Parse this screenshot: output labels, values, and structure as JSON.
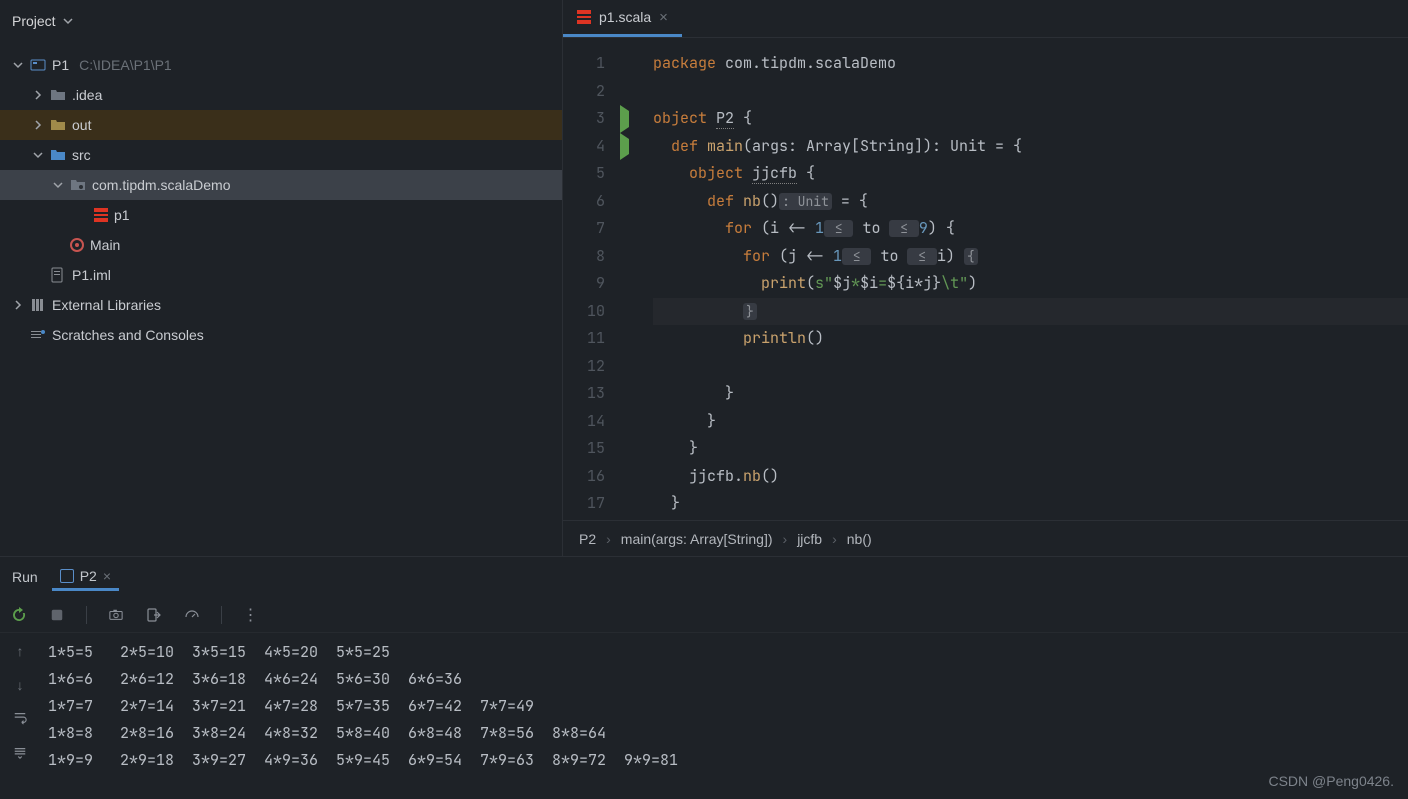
{
  "project": {
    "title": "Project",
    "root": {
      "name": "P1",
      "path": "C:\\IDEA\\P1\\P1"
    },
    "nodes": {
      "idea": ".idea",
      "out": "out",
      "src": "src",
      "pkg": "com.tipdm.scalaDemo",
      "p1": "p1",
      "main": "Main",
      "iml": "P1.iml",
      "ext": "External Libraries",
      "scratches": "Scratches and Consoles"
    }
  },
  "editor": {
    "tab_name": "p1.scala",
    "lines": {
      "1": {
        "segments": [
          {
            "t": "package ",
            "c": "kw"
          },
          {
            "t": "com.tipdm.scalaDemo",
            "c": "pkg"
          }
        ]
      },
      "2": {
        "segments": [
          {
            "t": "",
            "c": ""
          }
        ]
      },
      "3": {
        "segments": [
          {
            "t": "object ",
            "c": "kw"
          },
          {
            "t": "P2",
            "c": "decl"
          },
          {
            "t": " {",
            "c": ""
          }
        ]
      },
      "4": {
        "segments": [
          {
            "t": "  ",
            "c": ""
          },
          {
            "t": "def ",
            "c": "kw"
          },
          {
            "t": "main",
            "c": "fn"
          },
          {
            "t": "(args: Array[String]): Unit = {",
            "c": ""
          }
        ]
      },
      "5": {
        "segments": [
          {
            "t": "    ",
            "c": ""
          },
          {
            "t": "object ",
            "c": "kw"
          },
          {
            "t": "jjcfb",
            "c": "decl"
          },
          {
            "t": " {",
            "c": ""
          }
        ]
      },
      "6": {
        "segments": [
          {
            "t": "      ",
            "c": ""
          },
          {
            "t": "def ",
            "c": "kw"
          },
          {
            "t": "nb",
            "c": "fn"
          },
          {
            "t": "()",
            "c": ""
          },
          {
            "t": ": Unit",
            "c": "hint"
          },
          {
            "t": " = {",
            "c": ""
          }
        ]
      },
      "7": {
        "segments": [
          {
            "t": "        ",
            "c": ""
          },
          {
            "t": "for ",
            "c": "kw"
          },
          {
            "t": "(i <- ",
            "c": ""
          },
          {
            "t": "1",
            "c": "num"
          },
          {
            "t": " ≤ ",
            "c": "hint"
          },
          {
            "t": " to ",
            "c": ""
          },
          {
            "t": " ≤ ",
            "c": "hint"
          },
          {
            "t": "9",
            "c": "num"
          },
          {
            "t": ") {",
            "c": ""
          }
        ]
      },
      "8": {
        "segments": [
          {
            "t": "          ",
            "c": ""
          },
          {
            "t": "for ",
            "c": "kw"
          },
          {
            "t": "(j <- ",
            "c": ""
          },
          {
            "t": "1",
            "c": "num"
          },
          {
            "t": " ≤ ",
            "c": "hint"
          },
          {
            "t": " to ",
            "c": ""
          },
          {
            "t": " ≤ ",
            "c": "hint"
          },
          {
            "t": "i) ",
            "c": ""
          },
          {
            "t": "{",
            "c": "hint"
          }
        ]
      },
      "9": {
        "segments": [
          {
            "t": "            ",
            "c": ""
          },
          {
            "t": "print",
            "c": "fn"
          },
          {
            "t": "(",
            "c": ""
          },
          {
            "t": "s\"",
            "c": "str"
          },
          {
            "t": "$j",
            "c": ""
          },
          {
            "t": "*",
            "c": "str"
          },
          {
            "t": "$i",
            "c": ""
          },
          {
            "t": "=",
            "c": "str"
          },
          {
            "t": "${i*j}",
            "c": ""
          },
          {
            "t": "\\t\"",
            "c": "str"
          },
          {
            "t": ")",
            "c": ""
          }
        ]
      },
      "10": {
        "segments": [
          {
            "t": "          ",
            "c": ""
          },
          {
            "t": "}",
            "c": "hint"
          }
        ],
        "hl": true
      },
      "11": {
        "segments": [
          {
            "t": "          ",
            "c": ""
          },
          {
            "t": "println",
            "c": "fn"
          },
          {
            "t": "()",
            "c": ""
          }
        ]
      },
      "12": {
        "segments": [
          {
            "t": "",
            "c": ""
          }
        ]
      },
      "13": {
        "segments": [
          {
            "t": "        }",
            "c": ""
          }
        ]
      },
      "14": {
        "segments": [
          {
            "t": "      }",
            "c": ""
          }
        ]
      },
      "15": {
        "segments": [
          {
            "t": "    }",
            "c": ""
          }
        ]
      },
      "16": {
        "segments": [
          {
            "t": "    jjcfb.",
            "c": ""
          },
          {
            "t": "nb",
            "c": "fn"
          },
          {
            "t": "()",
            "c": ""
          }
        ]
      },
      "17": {
        "segments": [
          {
            "t": "  }",
            "c": ""
          }
        ]
      }
    },
    "run_markers": [
      3,
      4
    ]
  },
  "breadcrumb": [
    "P2",
    "main(args: Array[String])",
    "jjcfb",
    "nb()"
  ],
  "run": {
    "title": "Run",
    "tab": "P2",
    "output": [
      "1*5=5   2*5=10  3*5=15  4*5=20  5*5=25",
      "1*6=6   2*6=12  3*6=18  4*6=24  5*6=30  6*6=36",
      "1*7=7   2*7=14  3*7=21  4*7=28  5*7=35  6*7=42  7*7=49",
      "1*8=8   2*8=16  3*8=24  4*8=32  5*8=40  6*8=48  7*8=56  8*8=64",
      "1*9=9   2*9=18  3*9=27  4*9=36  5*9=45  6*9=54  7*9=63  8*9=72  9*9=81"
    ]
  },
  "watermark": "CSDN @Peng0426."
}
